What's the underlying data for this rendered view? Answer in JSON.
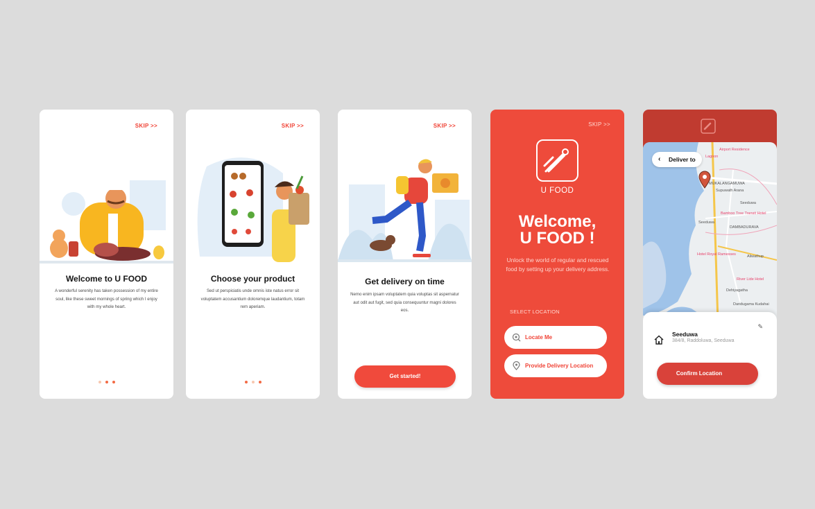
{
  "onboarding": [
    {
      "skip": "SKIP >>",
      "title": "Welcome to U FOOD",
      "desc": "A wonderful serenity has taken possession of my entire soul, like these sweet mornings of spring which I enjoy with my whole heart."
    },
    {
      "skip": "SKIP >>",
      "title": "Choose your product",
      "desc": "Sed ut perspiciatis unde omnis iste natus error sit voluptatem accusantium doloremque laudantium, totam rem aperiam."
    },
    {
      "skip": "SKIP >>",
      "title": "Get delivery on time",
      "desc": "Nemo enim ipsam voluptatem quia voluptas sit aspernatur aut odit aut fugit, sed quia consequuntur magni dolores eos.",
      "button": "Get started!"
    }
  ],
  "location_screen": {
    "skip": "SKIP >>",
    "brand": "U FOOD",
    "welcome_line1": "Welcome,",
    "welcome_line2": "U FOOD !",
    "desc": "Unlock the world of regular and rescued food by setting up your delivery address.",
    "select_label": "SELECT LOCATION",
    "locate_me": "Locate Me",
    "provide_location": "Provide Delivery Location"
  },
  "map_screen": {
    "deliver_to": "Deliver to",
    "address_title": "Seeduwa",
    "address_sub": "384/8, Raddoluwa, Seeduwa",
    "confirm": "Confirm Location",
    "map_labels": [
      "Airport Residence",
      "Lagoon",
      "MUKALANGAMUWA",
      "Supuwath Arana",
      "Seeduwa",
      "Bamboo Tree Transit Hotel",
      "DAMBADURAVA",
      "Seeduwa",
      "Hotel Royal Ramesses",
      "Aliwathup",
      "River Lide Hotel",
      "Dehiyagatha",
      "Dandugama Kudahai"
    ]
  },
  "colors": {
    "accent": "#f04336",
    "brand_bg": "#ee4b3b",
    "dot_active": "#f26a44"
  }
}
